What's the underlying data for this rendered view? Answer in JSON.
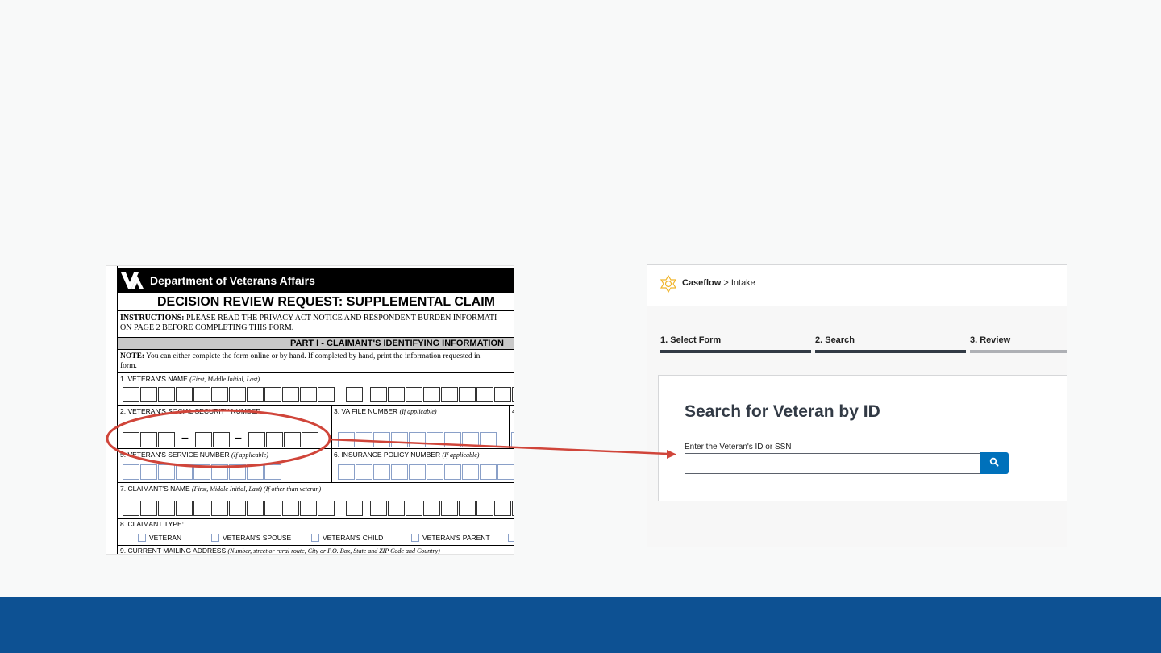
{
  "paper_form": {
    "department": "Department of Veterans Affairs",
    "title": "DECISION REVIEW REQUEST:  SUPPLEMENTAL CLAIM",
    "instructions_label": "INSTRUCTIONS:",
    "instructions_line1": " PLEASE READ THE PRIVACY ACT NOTICE AND RESPONDENT BURDEN INFORMATI",
    "instructions_line2": "ON PAGE 2 BEFORE COMPLETING THIS FORM.",
    "part_heading": "PART I - CLAIMANT'S IDENTIFYING INFORMATION",
    "note_label": "NOTE:",
    "note_line1": " You can either complete the form online or by hand.  If completed by hand, print the information requested in",
    "note_line2": "form.",
    "field1_label": "1. VETERAN'S NAME ",
    "field1_hint": "(First, Middle Initial, Last)",
    "field2_label": "2. VETERAN'S SOCIAL SECURITY NUMBER",
    "field3_label": "3. VA FILE NUMBER ",
    "field3_hint": "(If applicable)",
    "field4_num": "4",
    "field5_label": "5. VETERAN'S SERVICE NUMBER ",
    "field5_hint": "(If applicable)",
    "field6_label": "6.  INSURANCE POLICY NUMBER ",
    "field6_hint": "(If applicable)",
    "field7_label": "7. CLAIMANT'S NAME ",
    "field7_hint": "(First, Middle Initial, Last) (If other than veteran)",
    "field8_label": "8.  CLAIMANT TYPE:",
    "claimant_types": [
      "VETERAN",
      "VETERAN'S SPOUSE",
      "VETERAN'S CHILD",
      "VETERAN'S PARENT"
    ],
    "field9_label": "9.  CURRENT MAILING ADDRESS ",
    "field9_hint": "(Number, street or rural route, City or P.O. Box, State and ZIP Code and Country)",
    "ssn_dash": "–"
  },
  "caseflow": {
    "brand": "Caseflow",
    "breadcrumb": " > Intake",
    "steps": [
      {
        "label": "1. Select Form",
        "state": "complete"
      },
      {
        "label": "2. Search",
        "state": "current"
      },
      {
        "label": "3. Review",
        "state": "upcoming"
      }
    ],
    "heading": "Search for Veteran by ID",
    "field_label": "Enter the Veteran's ID or SSN",
    "input_value": "",
    "search_icon": "search-icon"
  },
  "colors": {
    "footer_blue": "#0d5193",
    "annotation_red": "#d0453a",
    "search_button": "#0071bb",
    "step_active": "#323a45",
    "step_inactive": "#aeb0b5"
  }
}
